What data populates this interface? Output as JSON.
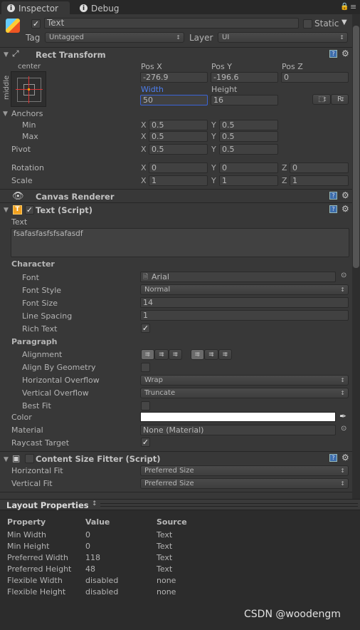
{
  "tabs": [
    {
      "label": "Inspector",
      "icon": "info-icon"
    },
    {
      "label": "Debug",
      "icon": "info-icon"
    }
  ],
  "object": {
    "name": "Text",
    "active": true,
    "static_label": "Static",
    "static": false,
    "tag_label": "Tag",
    "tag": "Untagged",
    "layer_label": "Layer",
    "layer": "UI"
  },
  "rect_transform": {
    "title": "Rect Transform",
    "anchor_h": "center",
    "anchor_v": "middle",
    "pos_x_label": "Pos X",
    "pos_y_label": "Pos Y",
    "pos_z_label": "Pos Z",
    "pos_x": "-276.9",
    "pos_y": "-196.6",
    "pos_z": "0",
    "width_label": "Width",
    "height_label": "Height",
    "width": "50",
    "height": "16",
    "raw_button": "R",
    "anchors_label": "Anchors",
    "min_label": "Min",
    "max_label": "Max",
    "pivot_label": "Pivot",
    "rotation_label": "Rotation",
    "scale_label": "Scale",
    "x": "X",
    "y": "Y",
    "z": "Z",
    "min_x": "0.5",
    "min_y": "0.5",
    "max_x": "0.5",
    "max_y": "0.5",
    "pivot_x": "0.5",
    "pivot_y": "0.5",
    "rot_x": "0",
    "rot_y": "0",
    "rot_z": "0",
    "scale_x": "1",
    "scale_y": "1",
    "scale_z": "1"
  },
  "canvas_renderer": {
    "title": "Canvas Renderer"
  },
  "text_script": {
    "title": "Text (Script)",
    "enabled": true,
    "text_label": "Text",
    "text": "fsafasfasfsfsafasdf",
    "character_label": "Character",
    "font_label": "Font",
    "font": "Arial",
    "font_style_label": "Font Style",
    "font_style": "Normal",
    "font_size_label": "Font Size",
    "font_size": "14",
    "line_spacing_label": "Line Spacing",
    "line_spacing": "1",
    "rich_text_label": "Rich Text",
    "rich_text": true,
    "paragraph_label": "Paragraph",
    "alignment_label": "Alignment",
    "align_geom_label": "Align By Geometry",
    "align_geom": false,
    "h_overflow_label": "Horizontal Overflow",
    "h_overflow": "Wrap",
    "v_overflow_label": "Vertical Overflow",
    "v_overflow": "Truncate",
    "best_fit_label": "Best Fit",
    "best_fit": false,
    "color_label": "Color",
    "color": "#ffffff",
    "material_label": "Material",
    "material": "None (Material)",
    "raycast_label": "Raycast Target",
    "raycast": true
  },
  "content_size_fitter": {
    "title": "Content Size Fitter (Script)",
    "enabled": false,
    "h_fit_label": "Horizontal Fit",
    "h_fit": "Preferred Size",
    "v_fit_label": "Vertical Fit",
    "v_fit": "Preferred Size"
  },
  "layout_properties": {
    "title": "Layout Properties",
    "columns": [
      "Property",
      "Value",
      "Source"
    ],
    "rows": [
      [
        "Min Width",
        "0",
        "Text"
      ],
      [
        "Min Height",
        "0",
        "Text"
      ],
      [
        "Preferred Width",
        "118",
        "Text"
      ],
      [
        "Preferred Height",
        "48",
        "Text"
      ],
      [
        "Flexible Width",
        "disabled",
        "none"
      ],
      [
        "Flexible Height",
        "disabled",
        "none"
      ]
    ]
  },
  "watermark": "CSDN @woodengm",
  "colors": {
    "background": "#383838",
    "selected_field": "#3b64d6",
    "component_icon": "#f0a020"
  }
}
